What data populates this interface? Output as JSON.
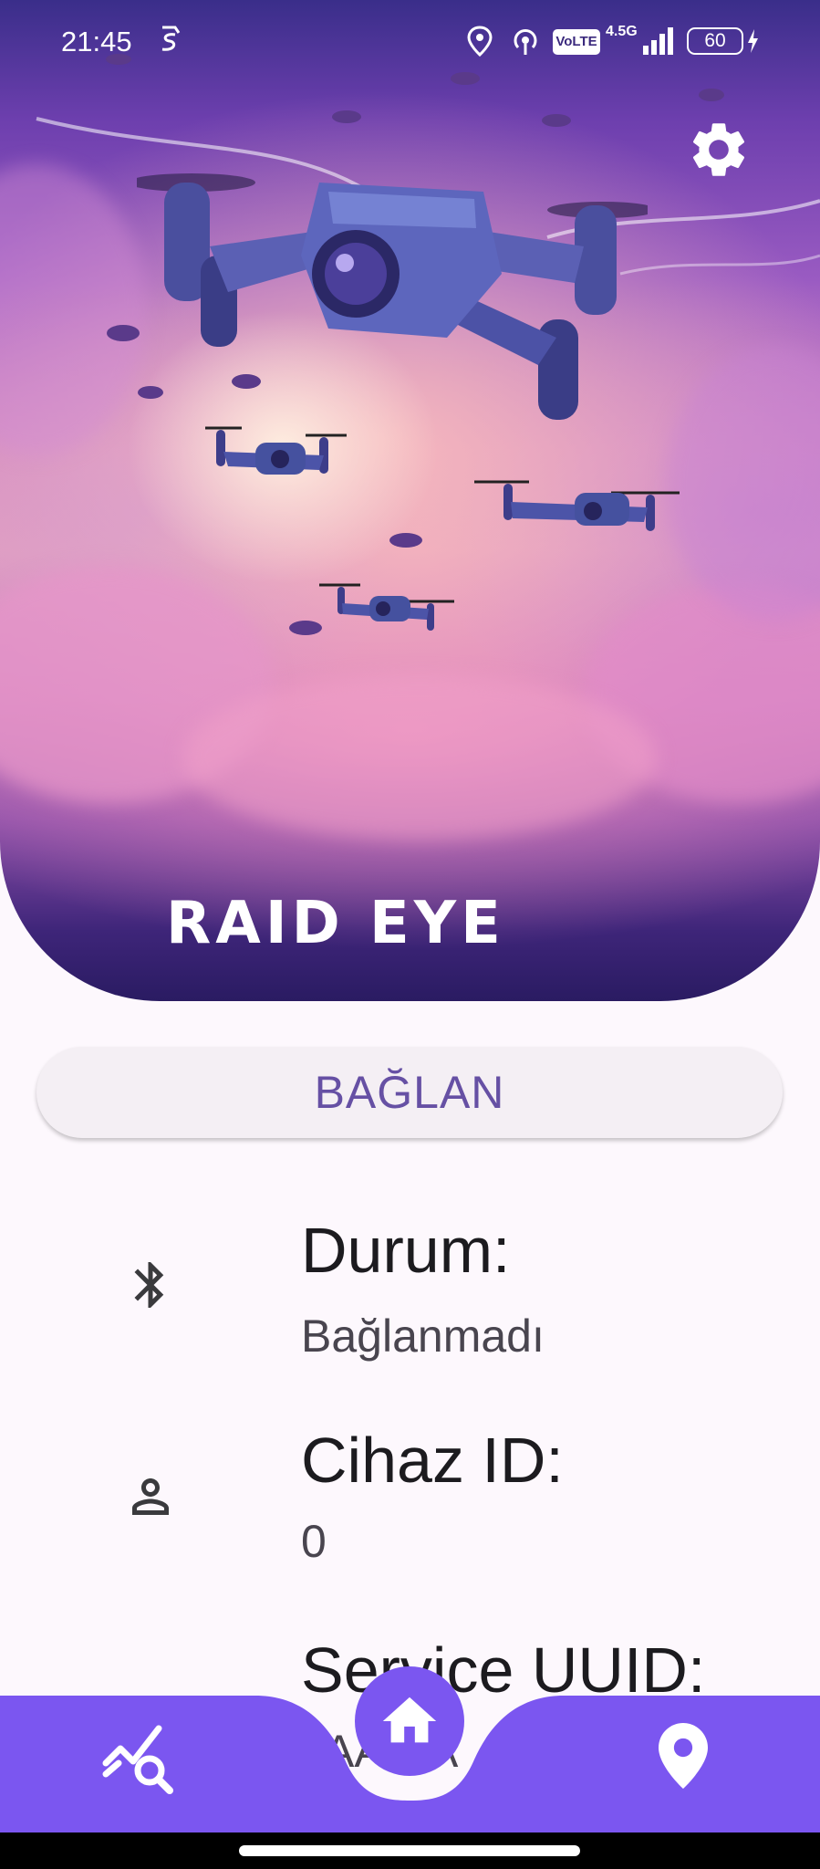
{
  "status_bar": {
    "time": "21:45",
    "network_label": "VoLTE",
    "network_type": "4.5G",
    "battery_level": "60",
    "icons": [
      "location-icon",
      "hotspot-icon",
      "signal-icon",
      "battery-icon",
      "charging-icon"
    ]
  },
  "hero": {
    "app_logo": "RAID EYE",
    "settings_icon": "gear-icon"
  },
  "connect_button": {
    "label": "BAĞLAN"
  },
  "info": {
    "status": {
      "title": "Durum:",
      "value": "Bağlanmadı",
      "icon": "bluetooth-icon"
    },
    "device_id": {
      "title": "Cihaz ID:",
      "value": "0",
      "icon": "person-icon"
    },
    "service_uuid": {
      "title": "Service UUID:",
      "value": "AA:AA"
    }
  },
  "bottom_nav": {
    "items": [
      {
        "name": "analytics",
        "icon": "chart-search-icon"
      },
      {
        "name": "home",
        "icon": "home-icon"
      },
      {
        "name": "map",
        "icon": "location-pin-icon"
      }
    ],
    "accent_color": "#7b56f0"
  },
  "colors": {
    "primary": "#6650a4",
    "nav": "#7b56f0",
    "background": "#fdf8fd"
  }
}
